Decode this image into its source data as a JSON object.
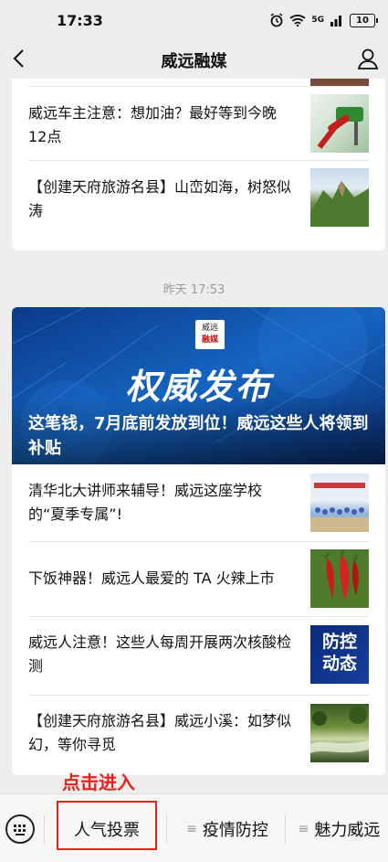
{
  "status": {
    "time": "17:33",
    "battery": "10",
    "network": "5G"
  },
  "nav": {
    "title": "威远融媒"
  },
  "top_articles": [
    {
      "title": "威远车主注意：想加油？最好等到今晚12点"
    },
    {
      "title": "【创建天府旅游名县】山峦如海，树怒似涛"
    }
  ],
  "date_label": "昨天 17:53",
  "banner": {
    "big_text": "权威发布",
    "logo_top": "威远",
    "logo_bottom": "融媒",
    "title": "这笔钱，7月底前发放到位！威远这些人将领到补贴"
  },
  "articles": [
    {
      "title": "清华北大讲师来辅导！威远这座学校的“夏季专属”!"
    },
    {
      "title": "下饭神器！威远人最爱的 TA 火辣上市"
    },
    {
      "title": "威远人注意！这些人每周开展两次核酸检测",
      "thumb_text": "防控动态"
    },
    {
      "title": "【创建天府旅游名县】威远小溪：如梦似幻，等你寻觅"
    }
  ],
  "annotation": "点击进入",
  "bottom_menu": [
    {
      "label": "人气投票"
    },
    {
      "label": "疫情防控"
    },
    {
      "label": "魅力威远"
    }
  ]
}
